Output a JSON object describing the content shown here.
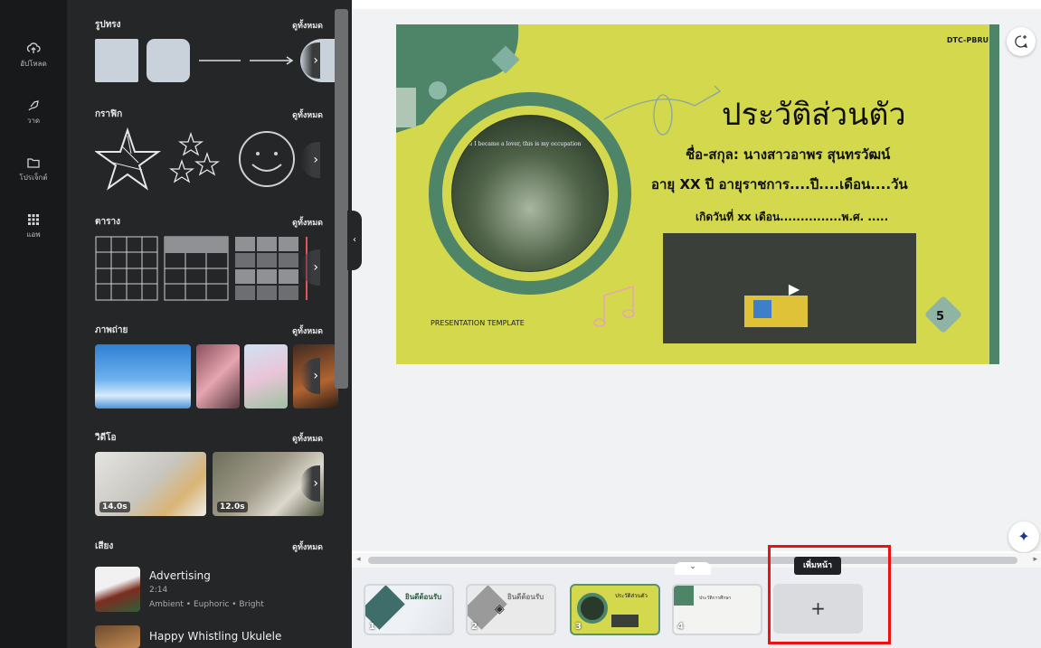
{
  "rail": {
    "items": [
      {
        "label": "อัปโหลด",
        "icon": "cloud-upload-icon"
      },
      {
        "label": "วาด",
        "icon": "draw-icon"
      },
      {
        "label": "โปรเจ็กต์",
        "icon": "folder-icon"
      },
      {
        "label": "แอพ",
        "icon": "apps-grid-icon"
      }
    ]
  },
  "panel": {
    "see_all": "ดูทั้งหมด",
    "sections": {
      "shapes": "รูปทรง",
      "graphics": "กราฟิก",
      "tables": "ตาราง",
      "photos": "ภาพถ่าย",
      "videos": "วิดีโอ",
      "audio": "เสียง"
    },
    "videos": [
      {
        "duration": "14.0s"
      },
      {
        "duration": "12.0s"
      }
    ],
    "audio": [
      {
        "title": "Advertising",
        "duration": "2:14",
        "tags": "Ambient • Euphoric • Bright"
      },
      {
        "title": "Happy Whistling Ukulele"
      }
    ]
  },
  "slide": {
    "brand": "DTC-PBRU",
    "title": "ประวัติส่วนตัว",
    "name_line": "ชื่อ-สกุล: นางสาวอาพร สุนทรวัฒน์",
    "age_line": "อายุ  XX  ปี อายุราชการ....ปี....เดือน....วัน",
    "birth_line": "เกิดวันที่ xx เดือน...............พ.ศ. .....",
    "template_label": "PRESENTATION TEMPLATE",
    "page_badge": "5",
    "photo_caption": "once I became a lover, this is my occupation"
  },
  "pages": {
    "thumbs": [
      {
        "num": "1",
        "text": "ยินดีต้อนรับ"
      },
      {
        "num": "2",
        "text": "ยินดีต้อนรับ"
      },
      {
        "num": "3",
        "text": "ประวัติส่วนตัว"
      },
      {
        "num": "4",
        "text": "ประวัติการศึกษา"
      }
    ],
    "add_label": "+",
    "tooltip": "เพิ่มหน้า"
  },
  "colors": {
    "accent_slide": "#d3d84d",
    "slide_green": "#4e8468",
    "highlight_red": "#e11111"
  }
}
